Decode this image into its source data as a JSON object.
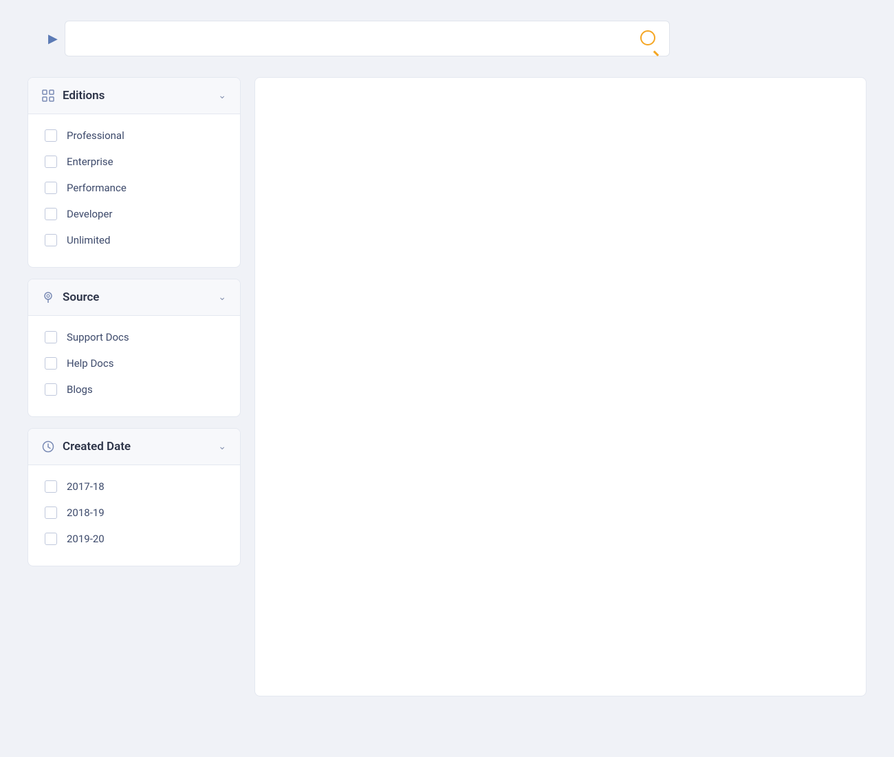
{
  "search": {
    "placeholder": "",
    "search_button_label": "Search"
  },
  "filters": [
    {
      "id": "editions",
      "title": "Editions",
      "icon": "grid",
      "expanded": true,
      "items": [
        {
          "label": "Professional",
          "checked": false
        },
        {
          "label": "Enterprise",
          "checked": false
        },
        {
          "label": "Performance",
          "checked": false
        },
        {
          "label": "Developer",
          "checked": false
        },
        {
          "label": "Unlimited",
          "checked": false
        }
      ]
    },
    {
      "id": "source",
      "title": "Source",
      "icon": "pin",
      "expanded": true,
      "items": [
        {
          "label": "Support Docs",
          "checked": false
        },
        {
          "label": "Help Docs",
          "checked": false
        },
        {
          "label": "Blogs",
          "checked": false
        }
      ]
    },
    {
      "id": "created-date",
      "title": "Created Date",
      "icon": "clock",
      "expanded": true,
      "items": [
        {
          "label": "2017-18",
          "checked": false
        },
        {
          "label": "2018-19",
          "checked": false
        },
        {
          "label": "2019-20",
          "checked": false
        }
      ]
    }
  ],
  "colors": {
    "accent": "#f5a623",
    "icon_color": "#7a8bb5",
    "text_primary": "#2c3347",
    "text_secondary": "#3d4a6b"
  }
}
